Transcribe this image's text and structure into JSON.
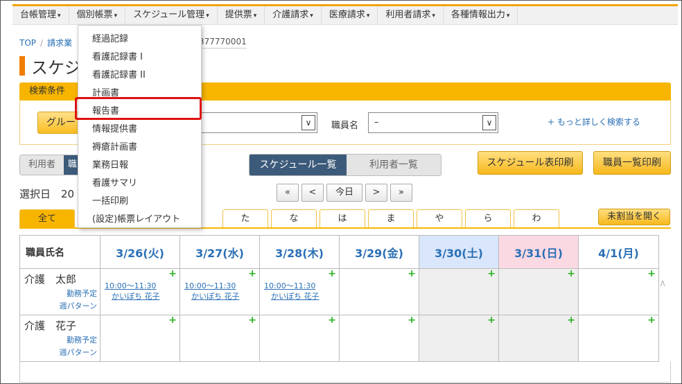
{
  "nav": [
    {
      "label": "台帳管理"
    },
    {
      "label": "個別帳票"
    },
    {
      "label": "スケジュール管理"
    },
    {
      "label": "提供票"
    },
    {
      "label": "介護請求"
    },
    {
      "label": "医療請求"
    },
    {
      "label": "利用者請求"
    },
    {
      "label": "各種情報出力"
    }
  ],
  "breadcrumb": {
    "top": "TOP",
    "second": "請求業",
    "id_fragment": "377770001"
  },
  "page_title": "スケジ",
  "search": {
    "header": "検索条件",
    "group_button": "グルー",
    "staff_label": "職員名",
    "staff_value": "–",
    "more_link": "+ もっと詳しく検索する"
  },
  "toggle_left": {
    "user": "利用者",
    "staff": "職"
  },
  "view_toggle": {
    "schedule": "スケジュール一覧",
    "users": "利用者一覧"
  },
  "buttons": {
    "print_schedule": "スケジュール表印刷",
    "print_staff": "職員一覧印刷",
    "open_unassigned": "未割当を開く"
  },
  "date_label": "選択日　20",
  "pager": {
    "first": "«",
    "prev": "<",
    "today": "今日",
    "next": ">",
    "last": "»"
  },
  "kana_tabs": [
    "全て",
    "た",
    "な",
    "は",
    "ま",
    "や",
    "ら",
    "わ"
  ],
  "grid": {
    "name_header": "職員氏名",
    "days": [
      "3/26(火)",
      "3/27(水)",
      "3/28(木)",
      "3/29(金)",
      "3/30(土)",
      "3/31(日)",
      "4/1(月)"
    ],
    "plus": "+",
    "staff": [
      {
        "name": "介護　太郎",
        "link1": "勤務予定",
        "link2": "週パターン",
        "appointments": [
          {
            "time": "10:00～11:30",
            "client": "かいぽち 花子"
          },
          {
            "time": "10:00～11:30",
            "client": "かいぽち 花子"
          },
          {
            "time": "10:00～11:30",
            "client": "かいぽち 花子"
          }
        ]
      },
      {
        "name": "介護　花子",
        "link1": "勤務予定",
        "link2": "週パターン"
      }
    ]
  },
  "dropdown": {
    "items": [
      "経過記録",
      "看護記録書 I",
      "看護記録書 II",
      "計画書",
      "報告書",
      "情報提供書",
      "褥瘡計画書",
      "業務日報",
      "看護サマリ",
      "一括印刷",
      "(設定)帳票レイアウト"
    ],
    "highlighted": "報告書"
  },
  "icons": {
    "caret": "▾",
    "select_arrow": "∨",
    "scroll_up": "∧"
  },
  "colors": {
    "accent": "#f8b500",
    "primary": "#3c5a7a",
    "link": "#2a6fb5",
    "highlight": "#e01010",
    "add": "#2bb020"
  }
}
